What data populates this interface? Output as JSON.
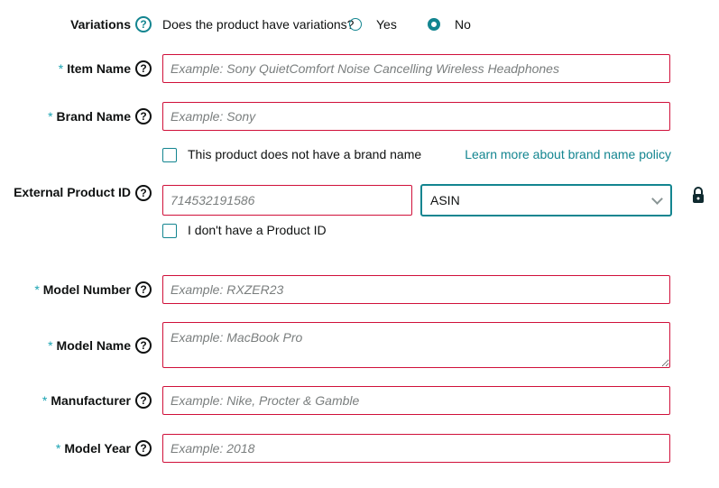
{
  "variations": {
    "label": "Variations",
    "question": "Does the product have variations?",
    "options": [
      "Yes",
      "No"
    ],
    "selected": "No"
  },
  "item_name": {
    "label": "Item Name",
    "required": "*",
    "placeholder": "Example: Sony QuietComfort Noise Cancelling Wireless Headphones"
  },
  "brand_name": {
    "label": "Brand Name",
    "required": "*",
    "placeholder": "Example: Sony",
    "no_brand_label": "This product does not have a brand name",
    "policy_link": "Learn more about brand name policy"
  },
  "external_id": {
    "label": "External Product ID",
    "placeholder": "714532191586",
    "type_value": "ASIN",
    "no_id_label": "I don't have a Product ID"
  },
  "model_number": {
    "label": "Model Number",
    "required": "*",
    "placeholder": "Example: RXZER23"
  },
  "model_name": {
    "label": "Model Name",
    "required": "*",
    "placeholder": "Example: MacBook Pro"
  },
  "manufacturer": {
    "label": "Manufacturer",
    "required": "*",
    "placeholder": "Example: Nike, Procter & Gamble"
  },
  "model_year": {
    "label": "Model Year",
    "required": "*",
    "placeholder": "Example: 2018"
  },
  "help_symbol": "?",
  "colors": {
    "accent": "#138590",
    "error": "#d0103a"
  }
}
